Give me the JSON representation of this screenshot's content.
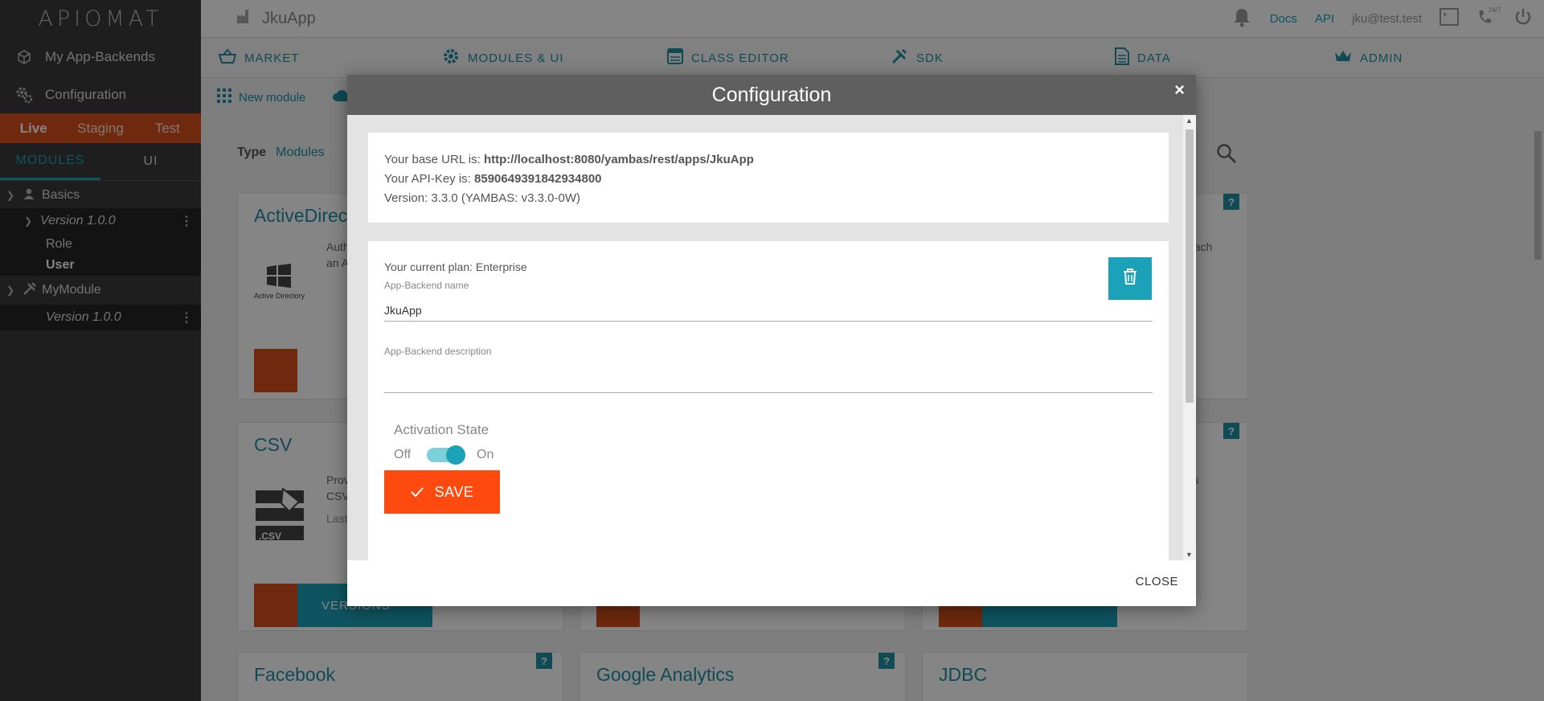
{
  "logo": {
    "text": "APIOMAT"
  },
  "sidebar": {
    "items": [
      {
        "label": "My App-Backends",
        "icon": "cube-icon"
      },
      {
        "label": "Configuration",
        "icon": "gears-icon"
      }
    ],
    "environments": [
      "Live",
      "Staging",
      "Test"
    ],
    "active_environment": "Live",
    "module_tabs": [
      "MODULES",
      "UI"
    ],
    "active_module_tab": "MODULES",
    "tree": {
      "basics": {
        "label": "Basics",
        "version": "Version 1.0.0",
        "classes": [
          "Role",
          "User"
        ]
      },
      "mymodule": {
        "label": "MyModule",
        "version": "Version 1.0.0"
      }
    }
  },
  "topbar": {
    "app_name": "JkuApp",
    "docs": "Docs",
    "api": "API",
    "user": "jku@test.test",
    "support_badge": "24/7"
  },
  "nav": {
    "tabs": [
      {
        "label": "MARKET",
        "icon": "basket-icon"
      },
      {
        "label": "MODULES & UI",
        "icon": "gear-icon"
      },
      {
        "label": "CLASS EDITOR",
        "icon": "window-icon"
      },
      {
        "label": "SDK",
        "icon": "tools-icon"
      },
      {
        "label": "DATA",
        "icon": "document-icon"
      },
      {
        "label": "ADMIN",
        "icon": "crown-icon"
      }
    ],
    "sub": {
      "new_module": "New module"
    }
  },
  "content": {
    "type_label": "Type",
    "type_value": "Modules",
    "cards": [
      {
        "title": "ActiveDirec",
        "text": "Auth",
        "text2": "an A",
        "logo_caption": "Active Directory"
      },
      {
        "title": "CSV",
        "text": "Prov",
        "text2": "CSV",
        "text3": "Last",
        "version_btn": "VERSIONS",
        "logo_caption": ".CSV"
      },
      {
        "title": "Facebook"
      },
      {
        "title": "Google Analytics"
      },
      {
        "title": "JDBC"
      }
    ],
    "right_snippets": [
      "each",
      "ils"
    ]
  },
  "modal": {
    "title": "Configuration",
    "close_x": "×",
    "base_url_label": "Your base URL is: ",
    "base_url": "http://localhost:8080/yambas/rest/apps/JkuApp",
    "api_key_label": "Your API-Key is: ",
    "api_key": "8590649391842934800",
    "version": "Version: 3.3.0 (YAMBAS: v3.3.0-0W)",
    "plan": "Your current plan: Enterprise",
    "name_label": "App-Backend name",
    "name_value": "JkuApp",
    "desc_label": "App-Backend description",
    "desc_value": "",
    "activation_label": "Activation State",
    "off": "Off",
    "on": "On",
    "activation_on": true,
    "save": "SAVE",
    "close": "CLOSE"
  },
  "colors": {
    "accent": "#1ba2b8",
    "orange": "#d4501b",
    "save": "#ff4a0f",
    "sidebar": "#3a3a3a"
  }
}
